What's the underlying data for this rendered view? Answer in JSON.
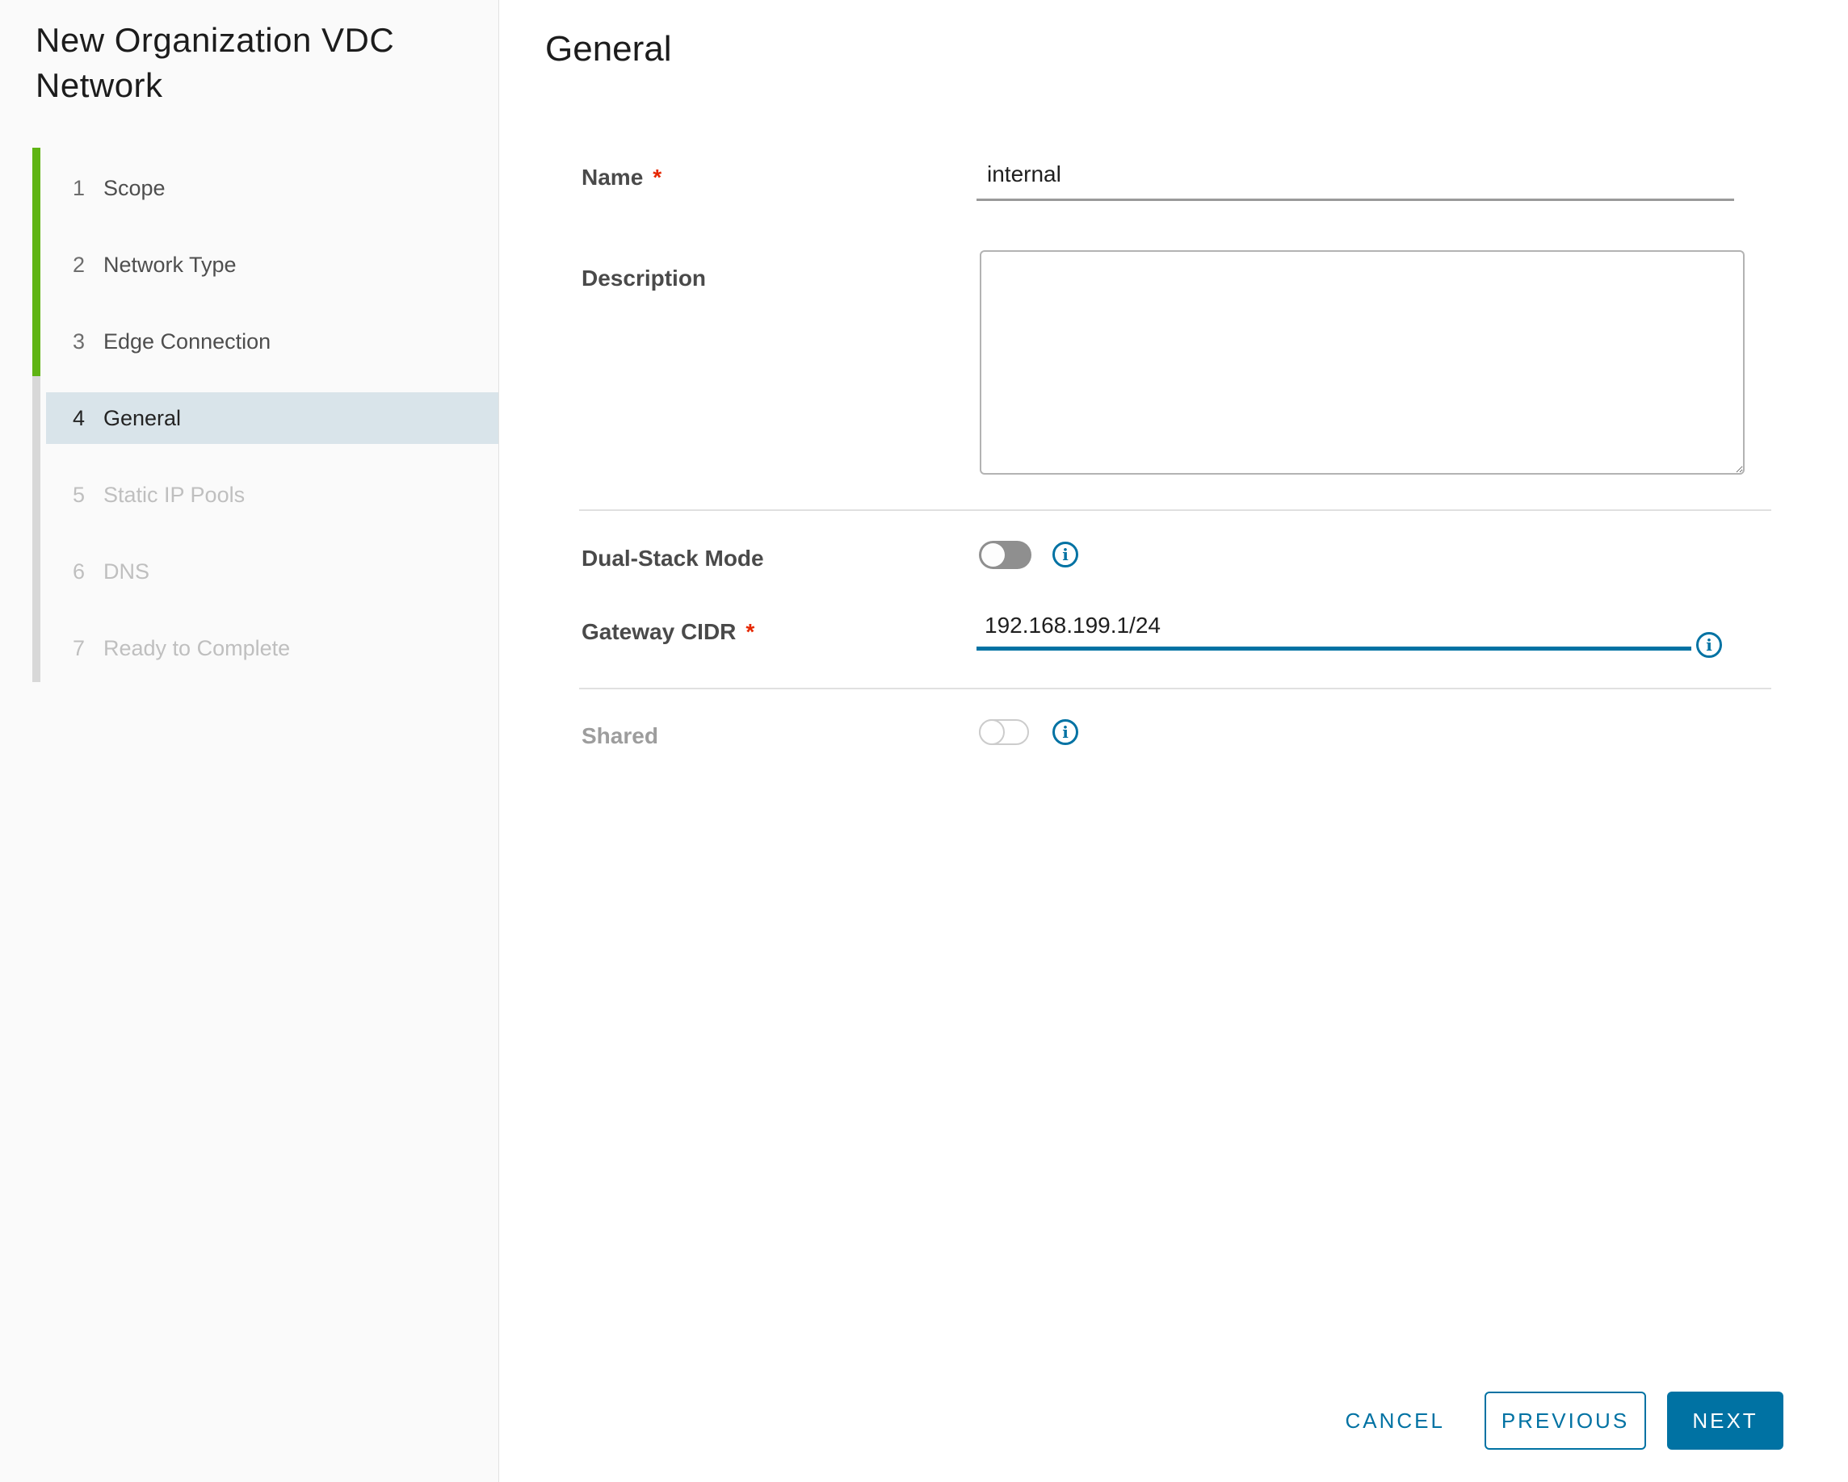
{
  "sidebar": {
    "title": "New Organization VDC Network",
    "active_step": "4",
    "completed_steps": [
      "1",
      "2",
      "3"
    ],
    "steps": [
      {
        "num": "1",
        "label": "Scope"
      },
      {
        "num": "2",
        "label": "Network Type"
      },
      {
        "num": "3",
        "label": "Edge Connection"
      },
      {
        "num": "4",
        "label": "General"
      },
      {
        "num": "5",
        "label": "Static IP Pools"
      },
      {
        "num": "6",
        "label": "DNS"
      },
      {
        "num": "7",
        "label": "Ready to Complete"
      }
    ]
  },
  "content": {
    "heading": "General",
    "fields": {
      "name": {
        "label": "Name",
        "required": true,
        "value": "internal"
      },
      "description": {
        "label": "Description",
        "value": ""
      },
      "dual_stack_mode": {
        "label": "Dual-Stack Mode",
        "state": "off"
      },
      "gateway_cidr": {
        "label": "Gateway CIDR",
        "required": true,
        "value": "192.168.199.1/24"
      },
      "shared": {
        "label": "Shared",
        "state": "off",
        "disabled": true
      }
    }
  },
  "footer": {
    "cancel_label": "CANCEL",
    "previous_label": "PREVIOUS",
    "next_label": "NEXT"
  },
  "colors": {
    "accent_blue": "#0072a3",
    "step_green": "#5fb413",
    "active_step_bg": "#d9e4ea",
    "required_red": "#e62700",
    "sidebar_bg": "#fafafa"
  }
}
